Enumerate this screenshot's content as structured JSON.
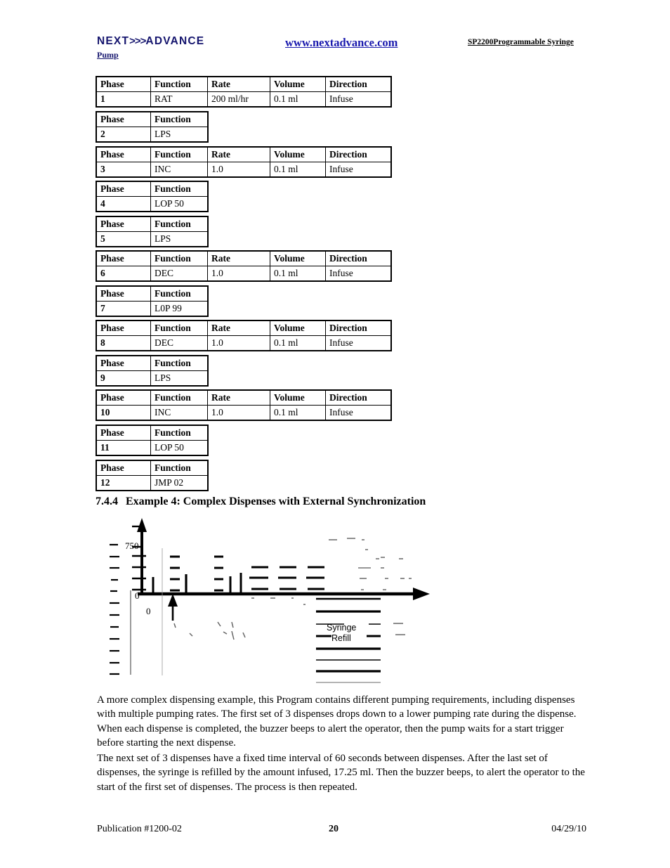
{
  "header": {
    "logo_text": "NEXT",
    "logo_chevrons": ">>>",
    "logo_text2": "ADVANCE",
    "logo_sub": "Pump",
    "url": "www.nextadvance.com",
    "product_title": "SP2200Programmable Syringe",
    "brand_color": "#15156e",
    "link_color": "#1a1aae"
  },
  "tables": {
    "headers_full": [
      "Phase",
      "Function",
      "Rate",
      "Volume",
      "Direction"
    ],
    "headers_short": [
      "Phase",
      "Function"
    ],
    "rows": [
      {
        "phase": "1",
        "function": "RAT",
        "rate": "200 ml/hr",
        "volume": "0.1 ml",
        "direction": "Infuse",
        "wide": true
      },
      {
        "phase": "2",
        "function": "LPS",
        "rate": "",
        "volume": "",
        "direction": "",
        "wide": false
      },
      {
        "phase": "3",
        "function": "INC",
        "rate": "1.0",
        "volume": "0.1 ml",
        "direction": "Infuse",
        "wide": true
      },
      {
        "phase": "4",
        "function": "LOP 50",
        "rate": "",
        "volume": "",
        "direction": "",
        "wide": false
      },
      {
        "phase": "5",
        "function": "LPS",
        "rate": "",
        "volume": "",
        "direction": "",
        "wide": false
      },
      {
        "phase": "6",
        "function": "DEC",
        "rate": "1.0",
        "volume": "0.1 ml",
        "direction": "Infuse",
        "wide": true
      },
      {
        "phase": "7",
        "function": "L0P 99",
        "rate": "",
        "volume": "",
        "direction": "",
        "wide": false
      },
      {
        "phase": "8",
        "function": "DEC",
        "rate": "1.0",
        "volume": "0.1 ml",
        "direction": "Infuse",
        "wide": true
      },
      {
        "phase": "9",
        "function": "LPS",
        "rate": "",
        "volume": "",
        "direction": "",
        "wide": false
      },
      {
        "phase": "10",
        "function": "INC",
        "rate": "1.0",
        "volume": "0.1 ml",
        "direction": "Infuse",
        "wide": true
      },
      {
        "phase": "11",
        "function": "LOP 50",
        "rate": "",
        "volume": "",
        "direction": "",
        "wide": false
      },
      {
        "phase": "12",
        "function": "JMP 02",
        "rate": "",
        "volume": "",
        "direction": "",
        "wide": false
      }
    ]
  },
  "section": {
    "number": "7.4.4",
    "title": "Example 4:  Complex Dispenses with External Synchronization"
  },
  "figure": {
    "y_axis_top_label": "750",
    "y_axis_zero_label": "0",
    "x_axis_zero_label": "0",
    "legend_line1": "Syringe",
    "legend_line2": "Refill"
  },
  "body": {
    "paragraph_1": "A more complex dispensing example, this Program contains different pumping requirements, including dispenses with multiple pumping rates.  The first set of 3 dispenses drops down to a lower pumping rate during the dispense.  When each dispense is completed, the buzzer beeps to alert the operator, then the pump waits for a start trigger before starting the next dispense.",
    "paragraph_2": "The next set of 3 dispenses have a fixed time interval of 60 seconds between dispenses.  After the last set of dispenses, the syringe is refilled by the amount infused, 17.25 ml.  Then the buzzer beeps, to alert the operator to the start of the first set of dispenses.  The process is then repeated."
  },
  "footer": {
    "publication": "Publication  #1200-02",
    "page_number": "20",
    "date": "04/29/10"
  }
}
